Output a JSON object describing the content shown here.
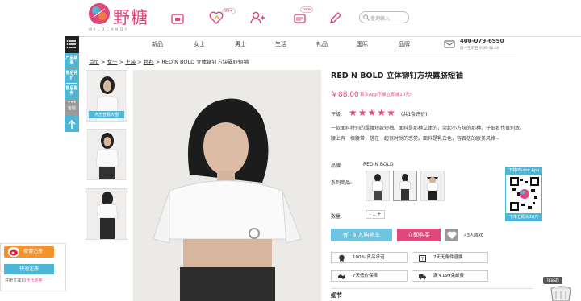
{
  "header": {
    "logo_text": "野糖",
    "logo_sub": "WILDCANDY",
    "search_placeholder": "查询输入",
    "icons": [
      "store-icon",
      "heart-icon",
      "add-user-icon",
      "message-icon",
      "edit-icon",
      "search-icon"
    ],
    "heart_badge": "99+",
    "message_badge": "new"
  },
  "nav": {
    "items": [
      "新品",
      "女士",
      "男士",
      "生活",
      "礼品",
      "国际",
      "品牌"
    ],
    "phone": "400-079-6990",
    "phone_hours": "周一至周五 9:00-18:00"
  },
  "sidebar": {
    "items": [
      "产品故事",
      "售后评价",
      "售后服务",
      "客服"
    ]
  },
  "breadcrumb": {
    "items": [
      "首页",
      "女士",
      "上装",
      "衬衫"
    ],
    "current": "RED N BOLD 立体铆钉方块露脐短袖"
  },
  "gallery": {
    "thumb_caption": "点击查看大图"
  },
  "product": {
    "title": "RED N BOLD 立体铆钉方块露脐短袖",
    "price": "￥88.00",
    "app_note": "首次App下单立即减10元!",
    "rating_label": "评级:",
    "stars": 5,
    "rating_count": "(共1条评价)",
    "description": "一款面料特别的露腰短款短袖。面料是那种立体的，突起小方块的那种。仔细看也很别致。腰上有一根腰带，搭在一起很时尚的感觉。面料是乳白色，容百搭的欧美风格~",
    "brand_label": "品牌:",
    "brand_value": "RED N BOLD",
    "series_label": "系列商品:",
    "qty_label": "数量:",
    "qty_value": "1",
    "qty_minus": "-",
    "qty_plus": "+",
    "cart_button": "加入购物车",
    "buy_button": "立即购买",
    "fav_count": "43人喜欢",
    "badges": [
      "100% 真品承诺",
      "7天无条件退换",
      "7天低价保障",
      "满￥199免邮费"
    ],
    "details_label": "细节"
  },
  "qr": {
    "top": "下载iPhone App",
    "bottom": "下单立即免10元"
  },
  "weibo": {
    "button": "微博注册",
    "quick": "快速注册",
    "note_prefix": "注册立减",
    "note_amount": "10元代金券"
  },
  "trash": "Trash",
  "colors": {
    "accent_pink": "#e0477a",
    "accent_blue": "#4db6d5",
    "orange": "#f5922a"
  }
}
